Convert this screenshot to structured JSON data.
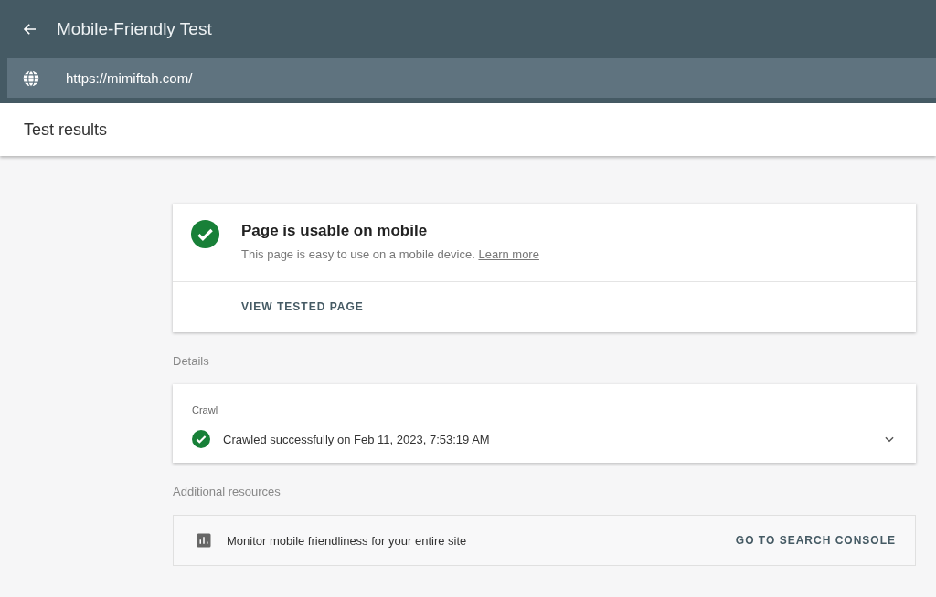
{
  "header": {
    "title": "Mobile-Friendly Test",
    "url": "https://mimiftah.com/"
  },
  "subheader": {
    "title": "Test results"
  },
  "result": {
    "passed": true,
    "title": "Page is usable on mobile",
    "description": "This page is easy to use on a mobile device.",
    "link": "Learn more",
    "action": "VIEW TESTED PAGE"
  },
  "details": {
    "heading": "Details",
    "section": "Crawl",
    "passed": true,
    "message": "Crawled successfully on Feb 11, 2023, 7:53:19 AM",
    "expanded": false
  },
  "resources": {
    "heading": "Additional resources",
    "text": "Monitor mobile friendliness for your entire site",
    "action": "GO TO SEARCH CONSOLE"
  }
}
